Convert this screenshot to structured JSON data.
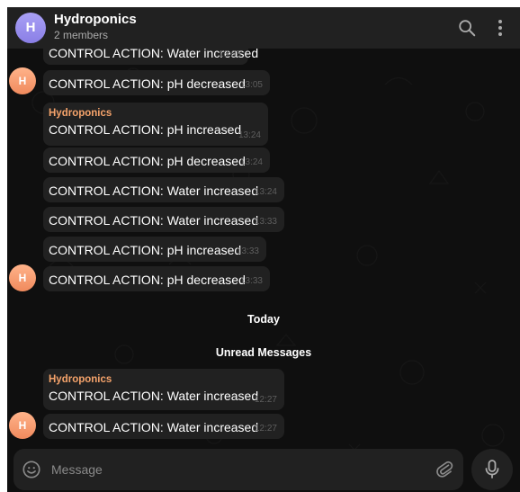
{
  "header": {
    "avatar_letter": "H",
    "title": "Hydroponics",
    "subtitle": "2 members",
    "icons": [
      "search-icon",
      "more-vertical-icon"
    ]
  },
  "messages": [
    {
      "text": "CONTROL ACTION: Water increased",
      "time": "13:05"
    },
    {
      "text": "CONTROL ACTION: pH decreased",
      "time": "13:05",
      "avatar": "H"
    },
    {
      "sender": "Hydroponics",
      "text": "CONTROL ACTION: pH increased",
      "time": "13:24"
    },
    {
      "text": "CONTROL ACTION: pH decreased",
      "time": "13:24"
    },
    {
      "text": "CONTROL ACTION: Water increased",
      "time": "13:24"
    },
    {
      "text": "CONTROL ACTION: Water increased",
      "time": "13:33"
    },
    {
      "text": "CONTROL ACTION: pH increased",
      "time": "13:33"
    },
    {
      "text": "CONTROL ACTION: pH decreased",
      "time": "13:33",
      "avatar": "H"
    },
    {
      "sender": "Hydroponics",
      "text": "CONTROL ACTION: Water increased",
      "time": "12:27"
    },
    {
      "text": "CONTROL ACTION: Water increased",
      "time": "12:27",
      "avatar": "H"
    }
  ],
  "separators": {
    "today": "Today",
    "unread": "Unread Messages"
  },
  "composer": {
    "placeholder": "Message",
    "icons": [
      "emoji-icon",
      "attach-icon",
      "mic-icon"
    ]
  },
  "colors": {
    "background": "#0f0f0f",
    "surface": "#212121",
    "sender_name": "#f5a36b",
    "header_avatar": "#8a7fe6",
    "message_avatar": "#f08a5d"
  }
}
